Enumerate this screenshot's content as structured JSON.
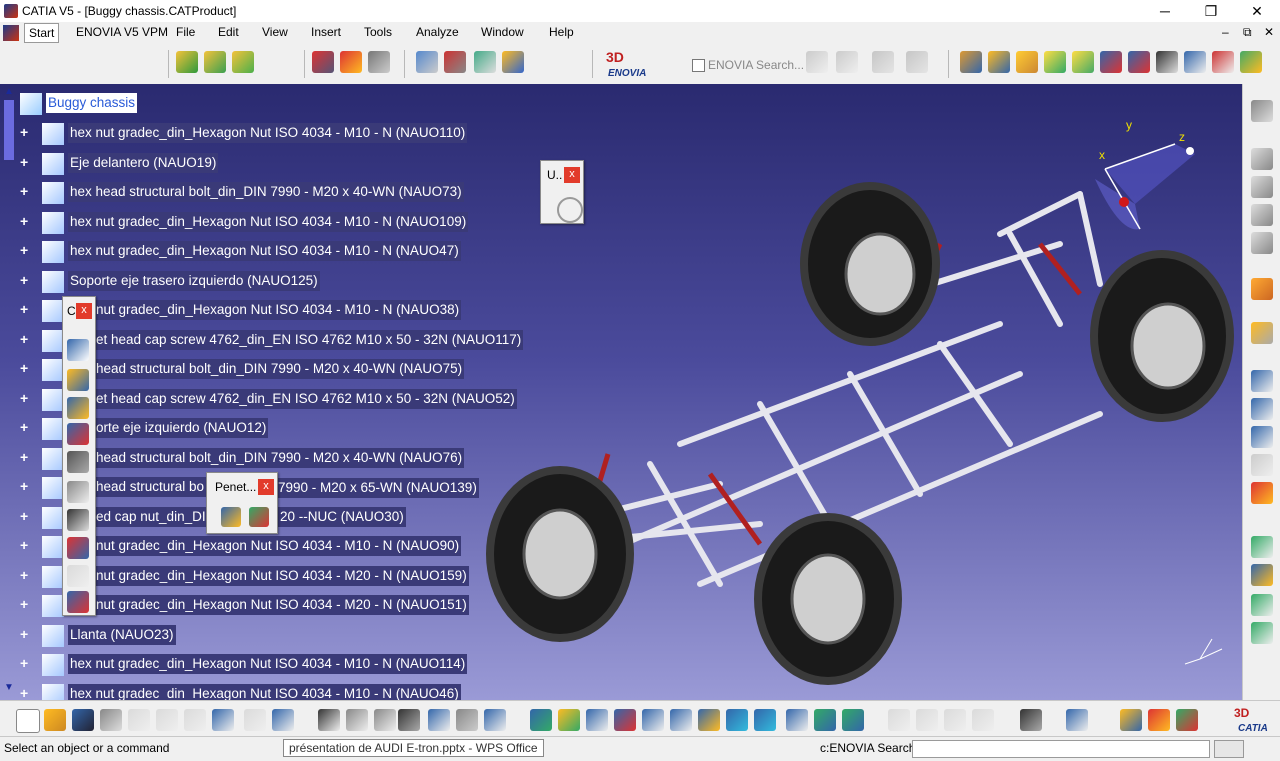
{
  "window": {
    "title": "CATIA V5 - [Buggy chassis.CATProduct]",
    "minimize": "─",
    "maximize": "❐",
    "close": "✕"
  },
  "menubar": {
    "items": [
      "Start",
      "ENOVIA V5 VPM",
      "File",
      "Edit",
      "View",
      "Insert",
      "Tools",
      "Analyze",
      "Window",
      "Help"
    ],
    "doc_controls": [
      "–",
      "⧉",
      "✕"
    ]
  },
  "toolbar": {
    "enovia_search_label": "ENOVIA Search...",
    "enovia_logo": "ENOVIA"
  },
  "tree": {
    "root": "Buggy chassis",
    "items": [
      "hex nut gradec_din_Hexagon Nut ISO 4034 - M10 - N (NAUO110)",
      "Eje delantero (NAUO19)",
      "hex head structural bolt_din_DIN 7990 - M20 x 40-WN (NAUO73)",
      "hex nut gradec_din_Hexagon Nut ISO 4034 - M10 - N (NAUO109)",
      "hex nut gradec_din_Hexagon Nut ISO 4034 - M10 - N (NAUO47)",
      "Soporte eje trasero izquierdo (NAUO125)",
      "nut gradec_din_Hexagon Nut ISO 4034 - M10 - N (NAUO38)",
      "et head cap screw 4762_din_EN ISO 4762 M10 x 50 - 32N (NAUO117)",
      "head structural bolt_din_DIN 7990 - M20 x 40-WN (NAUO75)",
      "et head cap screw 4762_din_EN ISO 4762 M10 x 50 - 32N (NAUO52)",
      "orte eje izquierdo (NAUO12)",
      "head structural bolt_din_DIN 7990 - M20 x 40-WN (NAUO76)",
      "head structural bo",
      "ed cap nut_din_DI",
      "nut gradec_din_Hexagon Nut ISO 4034 - M10 - N (NAUO90)",
      "nut gradec_din_Hexagon Nut ISO 4034 - M20 - N (NAUO159)",
      "nut gradec_din_Hexagon Nut ISO 4034 - M20 - N (NAUO151)",
      "Llanta (NAUO23)",
      "hex nut gradec_din_Hexagon Nut ISO 4034 - M10 - N (NAUO114)",
      "hex nut gradec_din_Hexagon Nut ISO 4034 - M10 - N (NAUO46)"
    ],
    "tail_texts": {
      "row13": "7990 - M20 x 65-WN (NAUO139)",
      "row14": "20 --NUC (NAUO30)"
    }
  },
  "floating": {
    "u_title": "U..",
    "c_title": "C",
    "penet_title": "Penet...",
    "close": "x"
  },
  "axis": {
    "x": "x",
    "y": "y",
    "z": "z"
  },
  "status": {
    "message": "Select an object or a command",
    "taskbar_tooltip": "présentation de AUDI E-tron.pptx - WPS Office",
    "enovia_label": "c:ENOVIA Search",
    "enovia_value": ""
  },
  "colors": {
    "viewport_top": "#2a2a70",
    "viewport_bottom": "#9a9ad6",
    "close_red": "#e23b2b"
  }
}
